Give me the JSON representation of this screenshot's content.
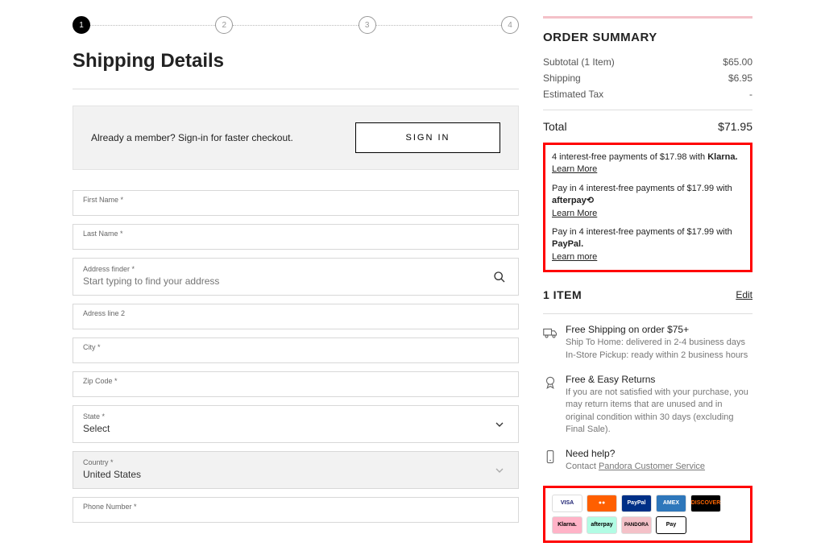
{
  "stepper": {
    "steps": [
      "1",
      "2",
      "3",
      "4"
    ],
    "active": 0
  },
  "title": "Shipping Details",
  "signin": {
    "text": "Already a member? Sign-in for faster checkout.",
    "button": "SIGN IN"
  },
  "fields": {
    "first_name": "First Name *",
    "last_name": "Last Name *",
    "address_finder": "Address finder *",
    "address_finder_ph": "Start typing to find your address",
    "address2": "Adress line 2",
    "city": "City *",
    "zip": "Zip Code *",
    "state": "State *",
    "state_value": "Select",
    "country": "Country *",
    "country_value": "United States",
    "phone": "Phone Number *"
  },
  "summary": {
    "title": "ORDER SUMMARY",
    "subtotal_label": "Subtotal (1 Item)",
    "subtotal": "$65.00",
    "shipping_label": "Shipping",
    "shipping": "$6.95",
    "tax_label": "Estimated Tax",
    "tax": "-",
    "total_label": "Total",
    "total": "$71.95"
  },
  "pay_later": {
    "klarna_text": "4 interest-free payments of $17.98 with ",
    "klarna_brand": "Klarna.",
    "afterpay_text": "Pay in 4 interest-free payments of $17.99 with ",
    "paypal_text": "Pay in 4 interest-free payments of $17.99 with ",
    "paypal_brand": "PayPal.",
    "learn_more": "Learn More",
    "learn_more2": "Learn more"
  },
  "items": {
    "title": "1 ITEM",
    "edit": "Edit"
  },
  "info": {
    "shipping_title": "Free Shipping on order $75+",
    "shipping_sub1": "Ship To Home: delivered in 2-4 business days",
    "shipping_sub2": "In-Store Pickup: ready within 2 business hours",
    "returns_title": "Free & Easy Returns",
    "returns_sub": "If you are not satisfied with your purchase, you may return items that are unused and in original condition within 30 days (excluding Final Sale).",
    "help_title": "Need help?",
    "help_prefix": "Contact ",
    "help_link": "Pandora Customer Service"
  },
  "pay_icons": {
    "visa": "VISA",
    "mc": "●●",
    "pp": "PayPal",
    "amex": "AMEX",
    "disc": "DISCOVER",
    "klarna": "Klarna.",
    "afterpay": "afterpay",
    "pandora": "PANDORA",
    "applepay": "Pay"
  }
}
